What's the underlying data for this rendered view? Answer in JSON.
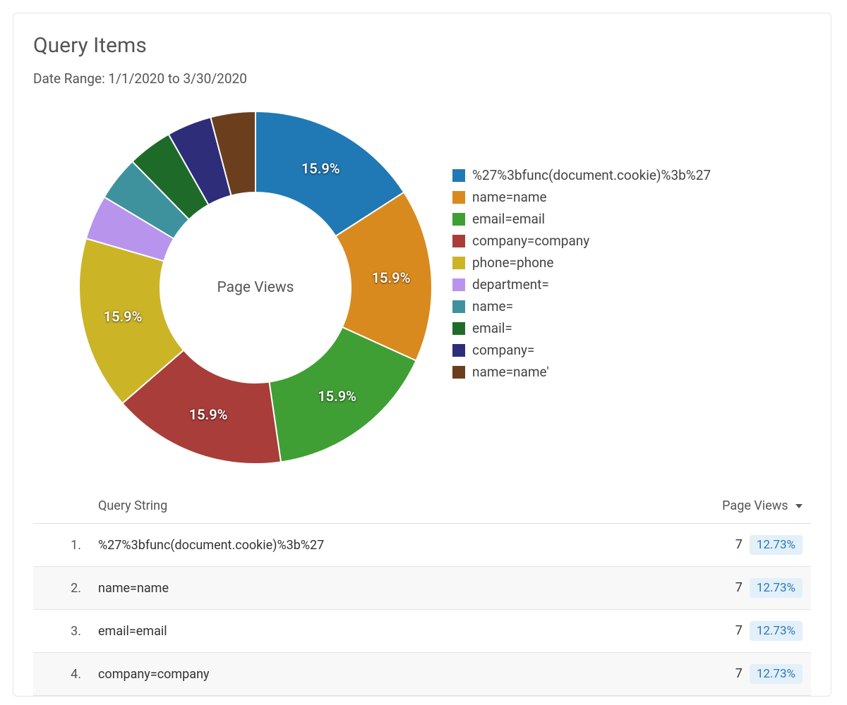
{
  "header": {
    "title": "Query Items",
    "date_range": "Date Range: 1/1/2020 to 3/30/2020"
  },
  "chart_data": {
    "type": "pie",
    "title": "Page Views",
    "slices": [
      {
        "label": "%27%3bfunc(document.cookie)%3b%27",
        "value": 15.9,
        "color": "#2079b4",
        "show_pct": true
      },
      {
        "label": "name=name",
        "value": 15.9,
        "color": "#d98a1e",
        "show_pct": true
      },
      {
        "label": "email=email",
        "value": 15.9,
        "color": "#3f9f34",
        "show_pct": true
      },
      {
        "label": "company=company",
        "value": 15.9,
        "color": "#a93d3a",
        "show_pct": true
      },
      {
        "label": "phone=phone",
        "value": 15.9,
        "color": "#ccb427",
        "show_pct": true
      },
      {
        "label": "department=",
        "value": 4.1,
        "color": "#b994ec",
        "show_pct": false
      },
      {
        "label": "name=",
        "value": 4.1,
        "color": "#3d929e",
        "show_pct": false
      },
      {
        "label": "email=",
        "value": 4.1,
        "color": "#1e6b29",
        "show_pct": false
      },
      {
        "label": "company=",
        "value": 4.1,
        "color": "#2d2d7a",
        "show_pct": false
      },
      {
        "label": "name=name'",
        "value": 4.1,
        "color": "#6b3f1e",
        "show_pct": false
      }
    ]
  },
  "table": {
    "columns": {
      "query": "Query String",
      "views": "Page Views"
    },
    "rows": [
      {
        "idx": "1.",
        "query": "%27%3bfunc(document.cookie)%3b%27",
        "count": "7",
        "pct": "12.73%"
      },
      {
        "idx": "2.",
        "query": "name=name",
        "count": "7",
        "pct": "12.73%"
      },
      {
        "idx": "3.",
        "query": "email=email",
        "count": "7",
        "pct": "12.73%"
      },
      {
        "idx": "4.",
        "query": "company=company",
        "count": "7",
        "pct": "12.73%"
      }
    ]
  }
}
